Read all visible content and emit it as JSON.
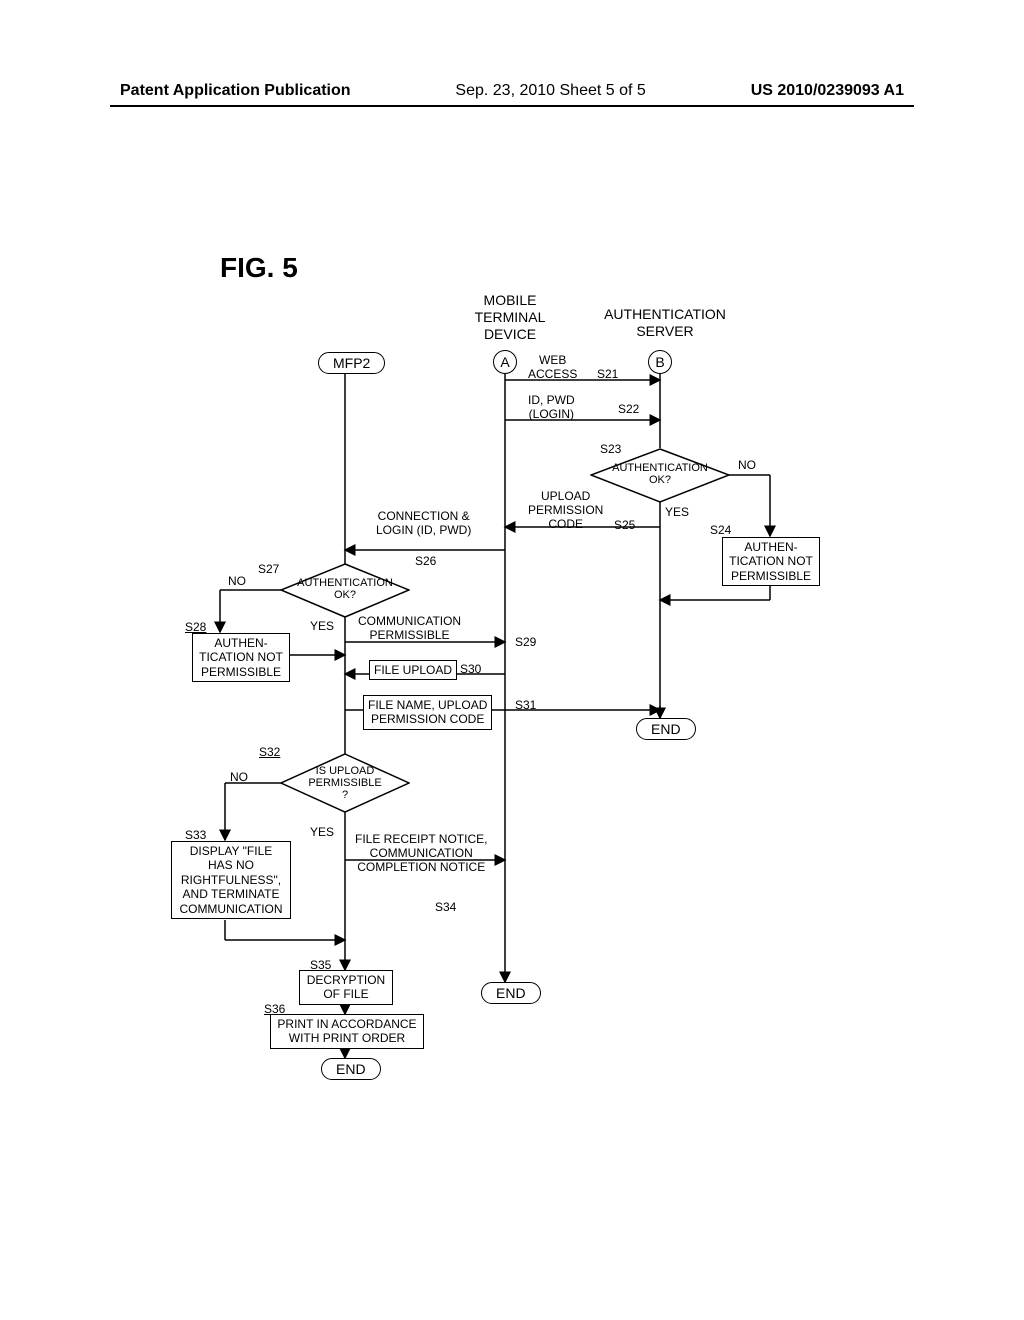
{
  "header": {
    "left": "Patent Application Publication",
    "center": "Sep. 23, 2010  Sheet 5 of 5",
    "right": "US 2010/0239093 A1"
  },
  "figure_label": "FIG. 5",
  "headings": {
    "mobile": "MOBILE\nTERMINAL\nDEVICE",
    "auth": "AUTHENTICATION\nSERVER"
  },
  "terminators": {
    "mfp2": "MFP2",
    "end1": "END",
    "end2": "END",
    "end3": "END"
  },
  "circles": {
    "a": "A",
    "b": "B"
  },
  "labels": {
    "web_access": "WEB\nACCESS",
    "id_pwd": "ID, PWD\n(LOGIN)",
    "upload_perm": "UPLOAD\nPERMISSION\nCODE",
    "conn_login": "CONNECTION &\nLOGIN (ID, PWD)",
    "comm_perm": "COMMUNICATION\nPERMISSIBLE",
    "file_upload": "FILE UPLOAD",
    "file_name": "FILE NAME, UPLOAD\nPERMISSION CODE",
    "file_receipt": "FILE RECEIPT NOTICE,\nCOMMUNICATION\nCOMPLETION NOTICE"
  },
  "boxes": {
    "auth_not_perm_24": "AUTHEN-\nTICATION NOT\nPERMISSIBLE",
    "auth_not_perm_28": "AUTHEN-\nTICATION NOT\nPERMISSIBLE",
    "display_file": "DISPLAY \"FILE\nHAS NO\nRIGHTFULNESS\",\nAND TERMINATE\nCOMMUNICATION",
    "decrypt": "DECRYPTION\nOF FILE",
    "print": "PRINT IN ACCORDANCE\nWITH PRINT ORDER"
  },
  "diamonds": {
    "s23": "AUTHENTICATION\nOK?",
    "s27": "AUTHENTICATION\nOK?",
    "s32": "IS UPLOAD\nPERMISSIBLE\n?"
  },
  "steps": {
    "s21": "S21",
    "s22": "S22",
    "s23": "S23",
    "s24": "S24",
    "s25": "S25",
    "s26": "S26",
    "s27": "S27",
    "s28": "S28",
    "s29": "S29",
    "s30": "S30",
    "s31": "S31",
    "s32": "S32",
    "s33": "S33",
    "s34": "S34",
    "s35": "S35",
    "s36": "S36"
  },
  "yesno": {
    "no": "NO",
    "yes": "YES"
  }
}
